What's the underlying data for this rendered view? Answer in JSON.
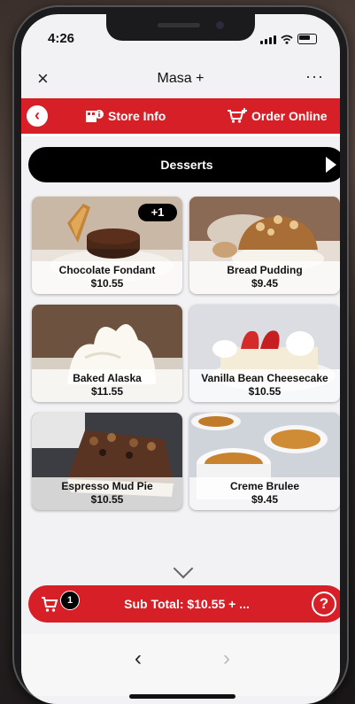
{
  "status_bar": {
    "time": "4:26"
  },
  "header": {
    "close_icon": "×",
    "title": "Masa +",
    "more_icon": "···"
  },
  "tabs": {
    "back_icon": "‹",
    "store_info": {
      "label": "Store Info",
      "icon": "store-info-icon"
    },
    "order_online": {
      "label": "Order Online",
      "icon": "cart-plus-icon"
    }
  },
  "category": {
    "label": "Desserts"
  },
  "menu_items": [
    {
      "name": "Chocolate Fondant",
      "price": "$10.55",
      "badge": "+1"
    },
    {
      "name": "Bread Pudding",
      "price": "$9.45"
    },
    {
      "name": "Baked Alaska",
      "price": "$11.55"
    },
    {
      "name": "Vanilla Bean Cheesecake",
      "price": "$10.55"
    },
    {
      "name": "Espresso Mud Pie",
      "price": "$10.55"
    },
    {
      "name": "Creme Brulee",
      "price": "$9.45"
    }
  ],
  "cart": {
    "count": "1",
    "subtotal": "Sub Total: $10.55 + ...",
    "help": "?"
  },
  "bottom_nav": {
    "prev": "‹",
    "next": "›"
  },
  "colors": {
    "brand_red": "#d61f26",
    "black": "#000000"
  }
}
